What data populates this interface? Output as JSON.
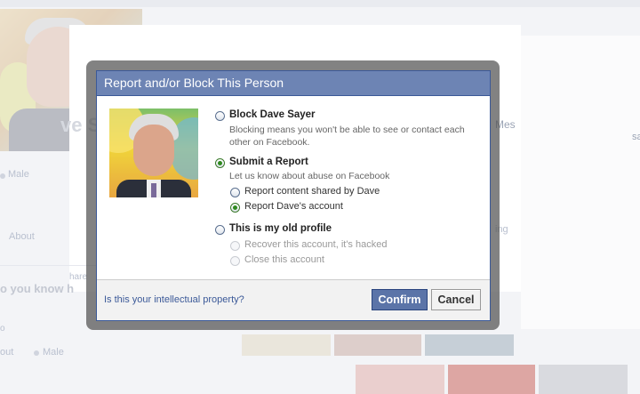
{
  "background": {
    "name_fragment": "ve S",
    "gender": "Male",
    "about": "About",
    "know_heading": "o you know h",
    "share_fragment": "hare",
    "messages_fragment": "Mes",
    "side_fragment": "sa",
    "ing_fragment": "ing",
    "bottom_out": "out",
    "bottom_male": "Male",
    "small_o": "o"
  },
  "dialog": {
    "title": "Report and/or Block This Person",
    "options": [
      {
        "label": "Block Dave Sayer",
        "description": "Blocking means you won't be able to see or contact each other on Facebook.",
        "checked": false
      },
      {
        "label": "Submit a Report",
        "description": "Let us know about abuse on Facebook",
        "checked": true,
        "suboptions": [
          {
            "label": "Report content shared by Dave",
            "checked": false
          },
          {
            "label": "Report Dave's account",
            "checked": true
          }
        ]
      },
      {
        "label": "This is my old profile",
        "checked": false,
        "suboptions": [
          {
            "label": "Recover this account, it's hacked",
            "disabled": true
          },
          {
            "label": "Close this account",
            "disabled": true
          }
        ]
      }
    ],
    "footer": {
      "ip_link": "Is this your intellectual property?",
      "confirm": "Confirm",
      "cancel": "Cancel"
    }
  },
  "colors": {
    "header": "#6d84b4",
    "header_border": "#3b5998",
    "link": "#3b5998",
    "confirm_button": "#5b74a8",
    "radio_checked": "#2f8a1f"
  },
  "icons": [
    "profile-photo",
    "radio-button"
  ]
}
